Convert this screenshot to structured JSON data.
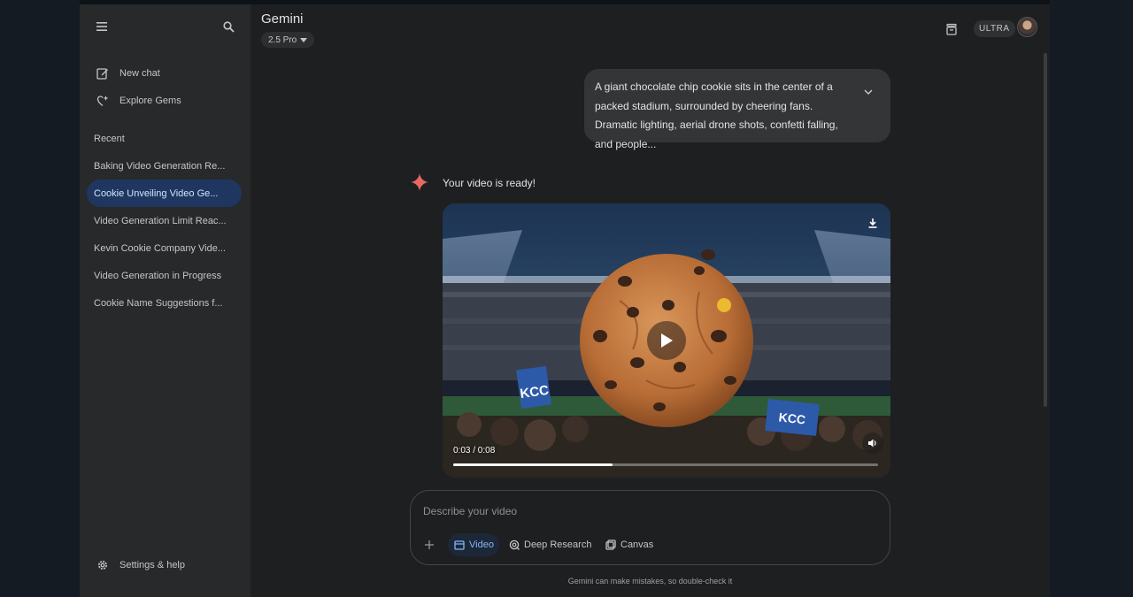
{
  "app": {
    "title": "Gemini",
    "model": "2.5 Pro",
    "plan_badge": "ULTRA"
  },
  "sidebar": {
    "new_chat": "New chat",
    "explore_gems": "Explore Gems",
    "recent_heading": "Recent",
    "recent": [
      {
        "label": "Baking Video Generation Re...",
        "active": false
      },
      {
        "label": "Cookie Unveiling Video Ge...",
        "active": true
      },
      {
        "label": "Video Generation Limit Reac...",
        "active": false
      },
      {
        "label": "Kevin Cookie Company Vide...",
        "active": false
      },
      {
        "label": "Video Generation in Progress",
        "active": false
      },
      {
        "label": "Cookie Name Suggestions f...",
        "active": false
      }
    ],
    "settings": "Settings & help"
  },
  "conversation": {
    "user_prompt": "A giant chocolate chip cookie sits in the center of a packed stadium, surrounded by cheering fans. Dramatic lighting, aerial drone shots, confetti falling, and people...",
    "response_text": "Your video is ready!",
    "video": {
      "time_display": "0:03 / 0:08",
      "progress": 0.375,
      "sign_text": "KCC",
      "sign_text_2": "KCC"
    }
  },
  "composer": {
    "placeholder": "Describe your video",
    "tools": [
      "Video",
      "Deep Research",
      "Canvas"
    ],
    "active_tool": "Video"
  },
  "disclaimer": "Gemini can make mistakes, so double-check it",
  "colors": {
    "accent": "#8ab4f8",
    "active_chat_bg": "#1f3760",
    "sparkle": "#e46962"
  }
}
